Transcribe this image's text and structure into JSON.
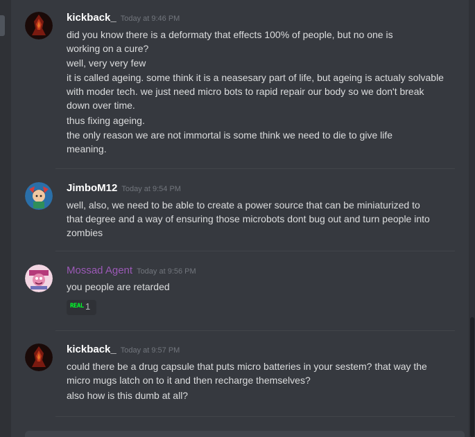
{
  "messages": [
    {
      "username": "kickback_",
      "timestamp": "Today at 9:46 PM",
      "lines": [
        "did you know there is a deformaty that effects 100% of people, but no one is working on a cure?",
        "well, very very few",
        "it is called ageing. some think  it is a neasesary part of life, but ageing is actualy solvable with moder tech. we just need micro bots to rapid repair our body so we don't break down over time.",
        "thus fixing ageing.",
        "the only reason we are not immortal is some think we need to die to give life meaning."
      ]
    },
    {
      "username": "JimboM12",
      "timestamp": "Today at 9:54 PM",
      "lines": [
        "well, also, we need to be able to create a power source that can be miniaturized to that degree and a way of ensuring those microbots dont bug out and turn people into zombies"
      ]
    },
    {
      "username": "Mossad Agent",
      "timestamp": "Today at 9:56 PM",
      "lines": [
        "you people are retarded"
      ],
      "reaction": {
        "emoji": "REAL",
        "count": "1"
      }
    },
    {
      "username": "kickback_",
      "timestamp": "Today at 9:57 PM",
      "lines": [
        "could there be a drug capsule that puts micro batteries in your sestem? that way the micro mugs latch on to it and then recharge themselves?",
        "also how is this dumb at all?"
      ]
    }
  ],
  "colors": {
    "background": "#36393f",
    "username_default": "#ffffff",
    "username_mossad": "#9b59b6",
    "message_text": "#dcddde",
    "timestamp": "#72767d",
    "reaction_emoji": "#00ff2a"
  },
  "icons": {
    "avatar_kickback": "dark-red-fire-avatar-icon",
    "avatar_jimbo": "anime-character-avatar-icon",
    "avatar_mossad": "pink-cartoon-avatar-icon"
  }
}
